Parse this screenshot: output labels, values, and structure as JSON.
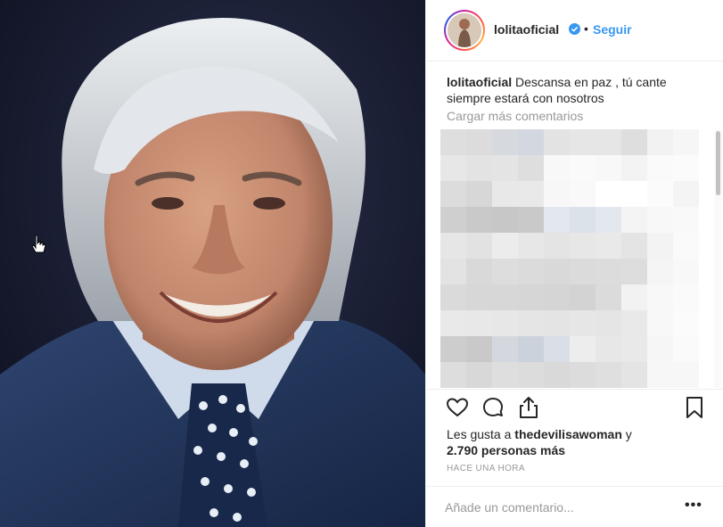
{
  "post": {
    "photo_alt": "",
    "author": "lolitaoficial",
    "verified": true,
    "separator": "•",
    "follow_label": "Seguir"
  },
  "caption": {
    "author": "lolitaoficial",
    "text": "Descansa en paz , tú cante siempre estará con nosotros"
  },
  "comments": {
    "load_more_label": "Cargar más comentarios",
    "blurred_colors": [
      [
        "#dedede",
        "#dcdcdc",
        "#d6d9de",
        "#d3d8e0",
        "#e3e3e3",
        "#e6e6e6",
        "#e6e6e6",
        "#dedede",
        "#f2f2f2",
        "#f6f6f6"
      ],
      [
        "#e7e7e7",
        "#e3e3e3",
        "#e4e4e4",
        "#dedede",
        "#f8f8f8",
        "#fafafa",
        "#f8f8f8",
        "#f3f3f3",
        "#fafafa",
        "#fbfbfb"
      ],
      [
        "#dcdcdc",
        "#d7d7d7",
        "#e8e8e8",
        "#e9e9e9",
        "#f7f7f7",
        "#f9f9f9",
        "#ffffff",
        "#ffffff",
        "#fbfbfb",
        "#f4f4f4"
      ],
      [
        "#cfcfcf",
        "#c9c9c9",
        "#c7c7c7",
        "#c9c9c9",
        "#e3e7ee",
        "#dce2ea",
        "#e3e8ef",
        "#f4f4f4",
        "#f8f8f8",
        "#f9f9f9"
      ],
      [
        "#e6e6e6",
        "#e2e2e2",
        "#ececec",
        "#e7e7e7",
        "#e4e4e4",
        "#e7e7e7",
        "#e9e9e9",
        "#e4e4e4",
        "#f3f3f3",
        "#fafafa"
      ],
      [
        "#e3e3e3",
        "#d9d9d9",
        "#dddddd",
        "#dbdbdb",
        "#d9d9d9",
        "#dbdbdb",
        "#dcdcdc",
        "#dddddd",
        "#f5f5f5",
        "#f8f8f8"
      ],
      [
        "#dadada",
        "#d7d7d7",
        "#d7d7d7",
        "#d6d6d6",
        "#d5d5d5",
        "#d3d3d3",
        "#dbdbdb",
        "#f2f2f2",
        "#f8f8f8",
        "#fafafa"
      ],
      [
        "#e9e9e9",
        "#e8e8e8",
        "#e7e7e7",
        "#e5e5e5",
        "#e4e4e4",
        "#e6e6e6",
        "#e5e5e5",
        "#e9e9e9",
        "#f8f8f8",
        "#fbfbfb"
      ],
      [
        "#cdcdcd",
        "#c9c9c9",
        "#d4d8de",
        "#ccd2db",
        "#dadfe7",
        "#ededed",
        "#e7e7e7",
        "#e9e9e9",
        "#f6f6f6",
        "#fafafa"
      ],
      [
        "#dddddd",
        "#d8d8d8",
        "#dedede",
        "#dcdcdc",
        "#d9d9d9",
        "#dcdcdc",
        "#dfdfdf",
        "#e4e4e4",
        "#f7f7f7",
        "#f7f7f7"
      ]
    ]
  },
  "likes": {
    "prefix": "Les gusta a",
    "liked_by": "thedevilisawoman",
    "conjunction": "y",
    "others": "2.790 personas más"
  },
  "timestamp": "HACE UNA HORA",
  "add_comment": {
    "placeholder": "Añade un comentario...",
    "more_label": "•••"
  },
  "colors": {
    "accent": "#3897f0",
    "text": "#262626",
    "muted": "#999999",
    "border": "#efefef",
    "photo_background": "#101325"
  }
}
